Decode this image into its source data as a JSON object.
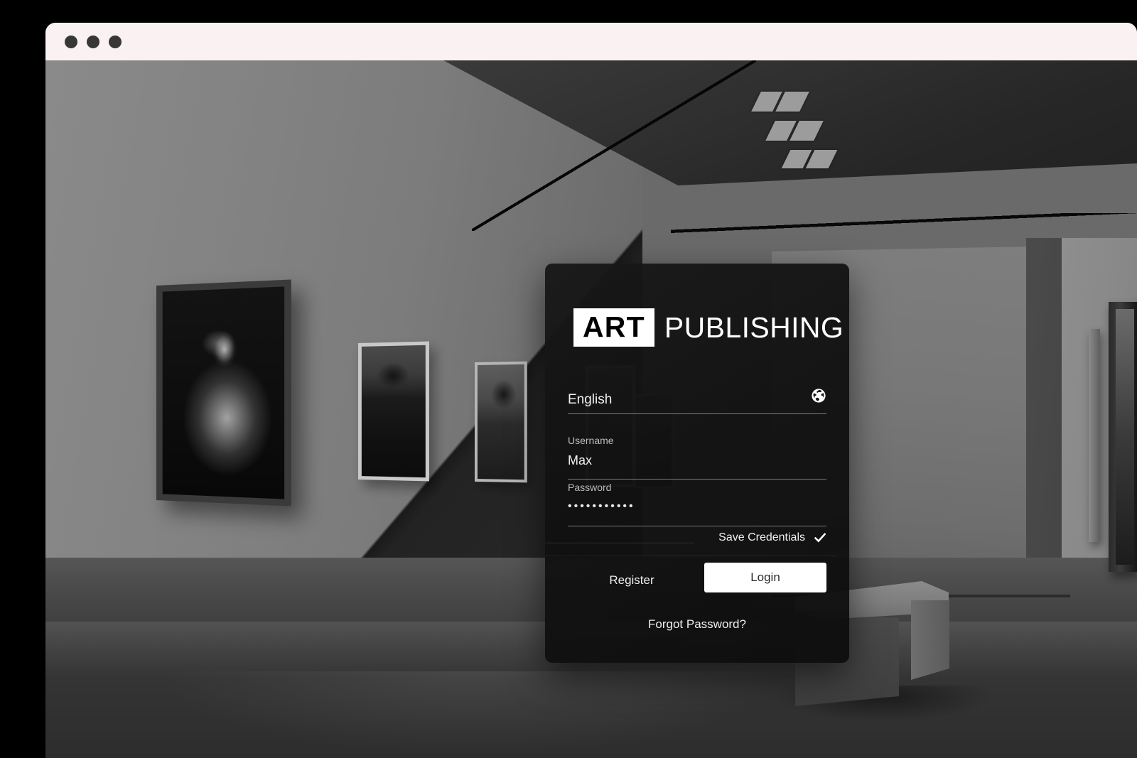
{
  "window": {
    "traffic_lights": [
      "close-dot",
      "minimize-dot",
      "maximize-dot"
    ],
    "titlebar_color": "#faf2f2",
    "dot_color": "#373737"
  },
  "background": {
    "scene": "art-gallery-interior",
    "description": "Grayscale art gallery with framed portraits on the left wall, dark ceiling with recessed light panels, a light far wall, polished floor and a gray bench in the foreground."
  },
  "login_card": {
    "logo": {
      "mark_text": "ART",
      "word_text": "PUBLISHING"
    },
    "language_field": {
      "value": "English",
      "icon": "globe-icon"
    },
    "username_field": {
      "label": "Username",
      "value": "Max",
      "placeholder": "Username"
    },
    "password_field": {
      "label": "Password",
      "value": "•••••••••••",
      "placeholder": "Password"
    },
    "save_credentials": {
      "label": "Save Credentials",
      "checked": true,
      "icon": "checkmark-icon"
    },
    "register_label": "Register",
    "login_label": "Login",
    "forgot_password_label": "Forgot Password?",
    "colors": {
      "card_background": "#111111",
      "primary_button_background": "#ffffff",
      "primary_button_text": "#2b2b2b",
      "text": "#f0f0f0",
      "muted_text": "#bdbdbd",
      "underline": "#7a7a7a"
    }
  }
}
